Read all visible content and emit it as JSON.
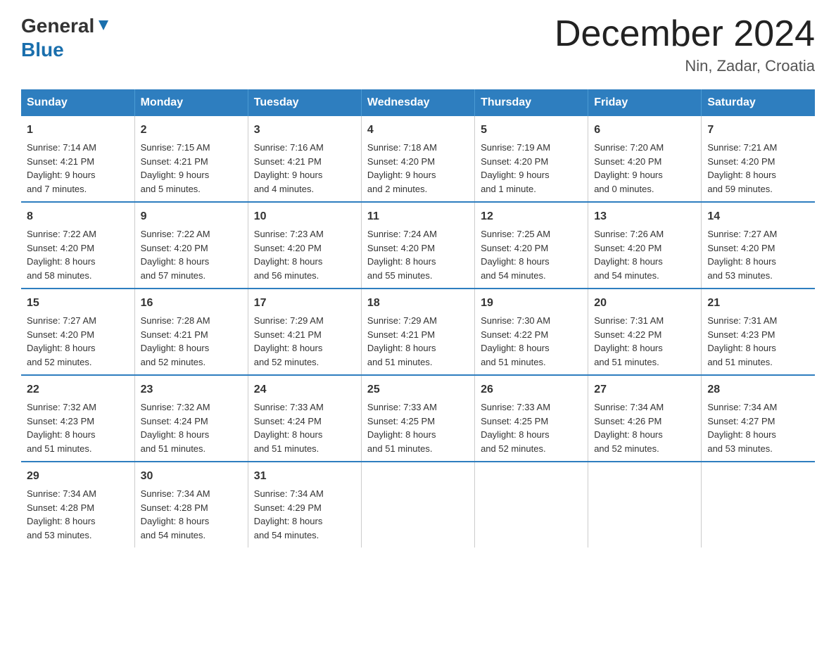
{
  "header": {
    "logo_general": "General",
    "logo_blue": "Blue",
    "month_title": "December 2024",
    "location": "Nin, Zadar, Croatia"
  },
  "days_of_week": [
    "Sunday",
    "Monday",
    "Tuesday",
    "Wednesday",
    "Thursday",
    "Friday",
    "Saturday"
  ],
  "weeks": [
    [
      {
        "day": "1",
        "sunrise": "7:14 AM",
        "sunset": "4:21 PM",
        "daylight": "9 hours and 7 minutes."
      },
      {
        "day": "2",
        "sunrise": "7:15 AM",
        "sunset": "4:21 PM",
        "daylight": "9 hours and 5 minutes."
      },
      {
        "day": "3",
        "sunrise": "7:16 AM",
        "sunset": "4:21 PM",
        "daylight": "9 hours and 4 minutes."
      },
      {
        "day": "4",
        "sunrise": "7:18 AM",
        "sunset": "4:20 PM",
        "daylight": "9 hours and 2 minutes."
      },
      {
        "day": "5",
        "sunrise": "7:19 AM",
        "sunset": "4:20 PM",
        "daylight": "9 hours and 1 minute."
      },
      {
        "day": "6",
        "sunrise": "7:20 AM",
        "sunset": "4:20 PM",
        "daylight": "9 hours and 0 minutes."
      },
      {
        "day": "7",
        "sunrise": "7:21 AM",
        "sunset": "4:20 PM",
        "daylight": "8 hours and 59 minutes."
      }
    ],
    [
      {
        "day": "8",
        "sunrise": "7:22 AM",
        "sunset": "4:20 PM",
        "daylight": "8 hours and 58 minutes."
      },
      {
        "day": "9",
        "sunrise": "7:22 AM",
        "sunset": "4:20 PM",
        "daylight": "8 hours and 57 minutes."
      },
      {
        "day": "10",
        "sunrise": "7:23 AM",
        "sunset": "4:20 PM",
        "daylight": "8 hours and 56 minutes."
      },
      {
        "day": "11",
        "sunrise": "7:24 AM",
        "sunset": "4:20 PM",
        "daylight": "8 hours and 55 minutes."
      },
      {
        "day": "12",
        "sunrise": "7:25 AM",
        "sunset": "4:20 PM",
        "daylight": "8 hours and 54 minutes."
      },
      {
        "day": "13",
        "sunrise": "7:26 AM",
        "sunset": "4:20 PM",
        "daylight": "8 hours and 54 minutes."
      },
      {
        "day": "14",
        "sunrise": "7:27 AM",
        "sunset": "4:20 PM",
        "daylight": "8 hours and 53 minutes."
      }
    ],
    [
      {
        "day": "15",
        "sunrise": "7:27 AM",
        "sunset": "4:20 PM",
        "daylight": "8 hours and 52 minutes."
      },
      {
        "day": "16",
        "sunrise": "7:28 AM",
        "sunset": "4:21 PM",
        "daylight": "8 hours and 52 minutes."
      },
      {
        "day": "17",
        "sunrise": "7:29 AM",
        "sunset": "4:21 PM",
        "daylight": "8 hours and 52 minutes."
      },
      {
        "day": "18",
        "sunrise": "7:29 AM",
        "sunset": "4:21 PM",
        "daylight": "8 hours and 51 minutes."
      },
      {
        "day": "19",
        "sunrise": "7:30 AM",
        "sunset": "4:22 PM",
        "daylight": "8 hours and 51 minutes."
      },
      {
        "day": "20",
        "sunrise": "7:31 AM",
        "sunset": "4:22 PM",
        "daylight": "8 hours and 51 minutes."
      },
      {
        "day": "21",
        "sunrise": "7:31 AM",
        "sunset": "4:23 PM",
        "daylight": "8 hours and 51 minutes."
      }
    ],
    [
      {
        "day": "22",
        "sunrise": "7:32 AM",
        "sunset": "4:23 PM",
        "daylight": "8 hours and 51 minutes."
      },
      {
        "day": "23",
        "sunrise": "7:32 AM",
        "sunset": "4:24 PM",
        "daylight": "8 hours and 51 minutes."
      },
      {
        "day": "24",
        "sunrise": "7:33 AM",
        "sunset": "4:24 PM",
        "daylight": "8 hours and 51 minutes."
      },
      {
        "day": "25",
        "sunrise": "7:33 AM",
        "sunset": "4:25 PM",
        "daylight": "8 hours and 51 minutes."
      },
      {
        "day": "26",
        "sunrise": "7:33 AM",
        "sunset": "4:25 PM",
        "daylight": "8 hours and 52 minutes."
      },
      {
        "day": "27",
        "sunrise": "7:34 AM",
        "sunset": "4:26 PM",
        "daylight": "8 hours and 52 minutes."
      },
      {
        "day": "28",
        "sunrise": "7:34 AM",
        "sunset": "4:27 PM",
        "daylight": "8 hours and 53 minutes."
      }
    ],
    [
      {
        "day": "29",
        "sunrise": "7:34 AM",
        "sunset": "4:28 PM",
        "daylight": "8 hours and 53 minutes."
      },
      {
        "day": "30",
        "sunrise": "7:34 AM",
        "sunset": "4:28 PM",
        "daylight": "8 hours and 54 minutes."
      },
      {
        "day": "31",
        "sunrise": "7:34 AM",
        "sunset": "4:29 PM",
        "daylight": "8 hours and 54 minutes."
      },
      null,
      null,
      null,
      null
    ]
  ],
  "labels": {
    "sunrise": "Sunrise:",
    "sunset": "Sunset:",
    "daylight": "Daylight:"
  }
}
